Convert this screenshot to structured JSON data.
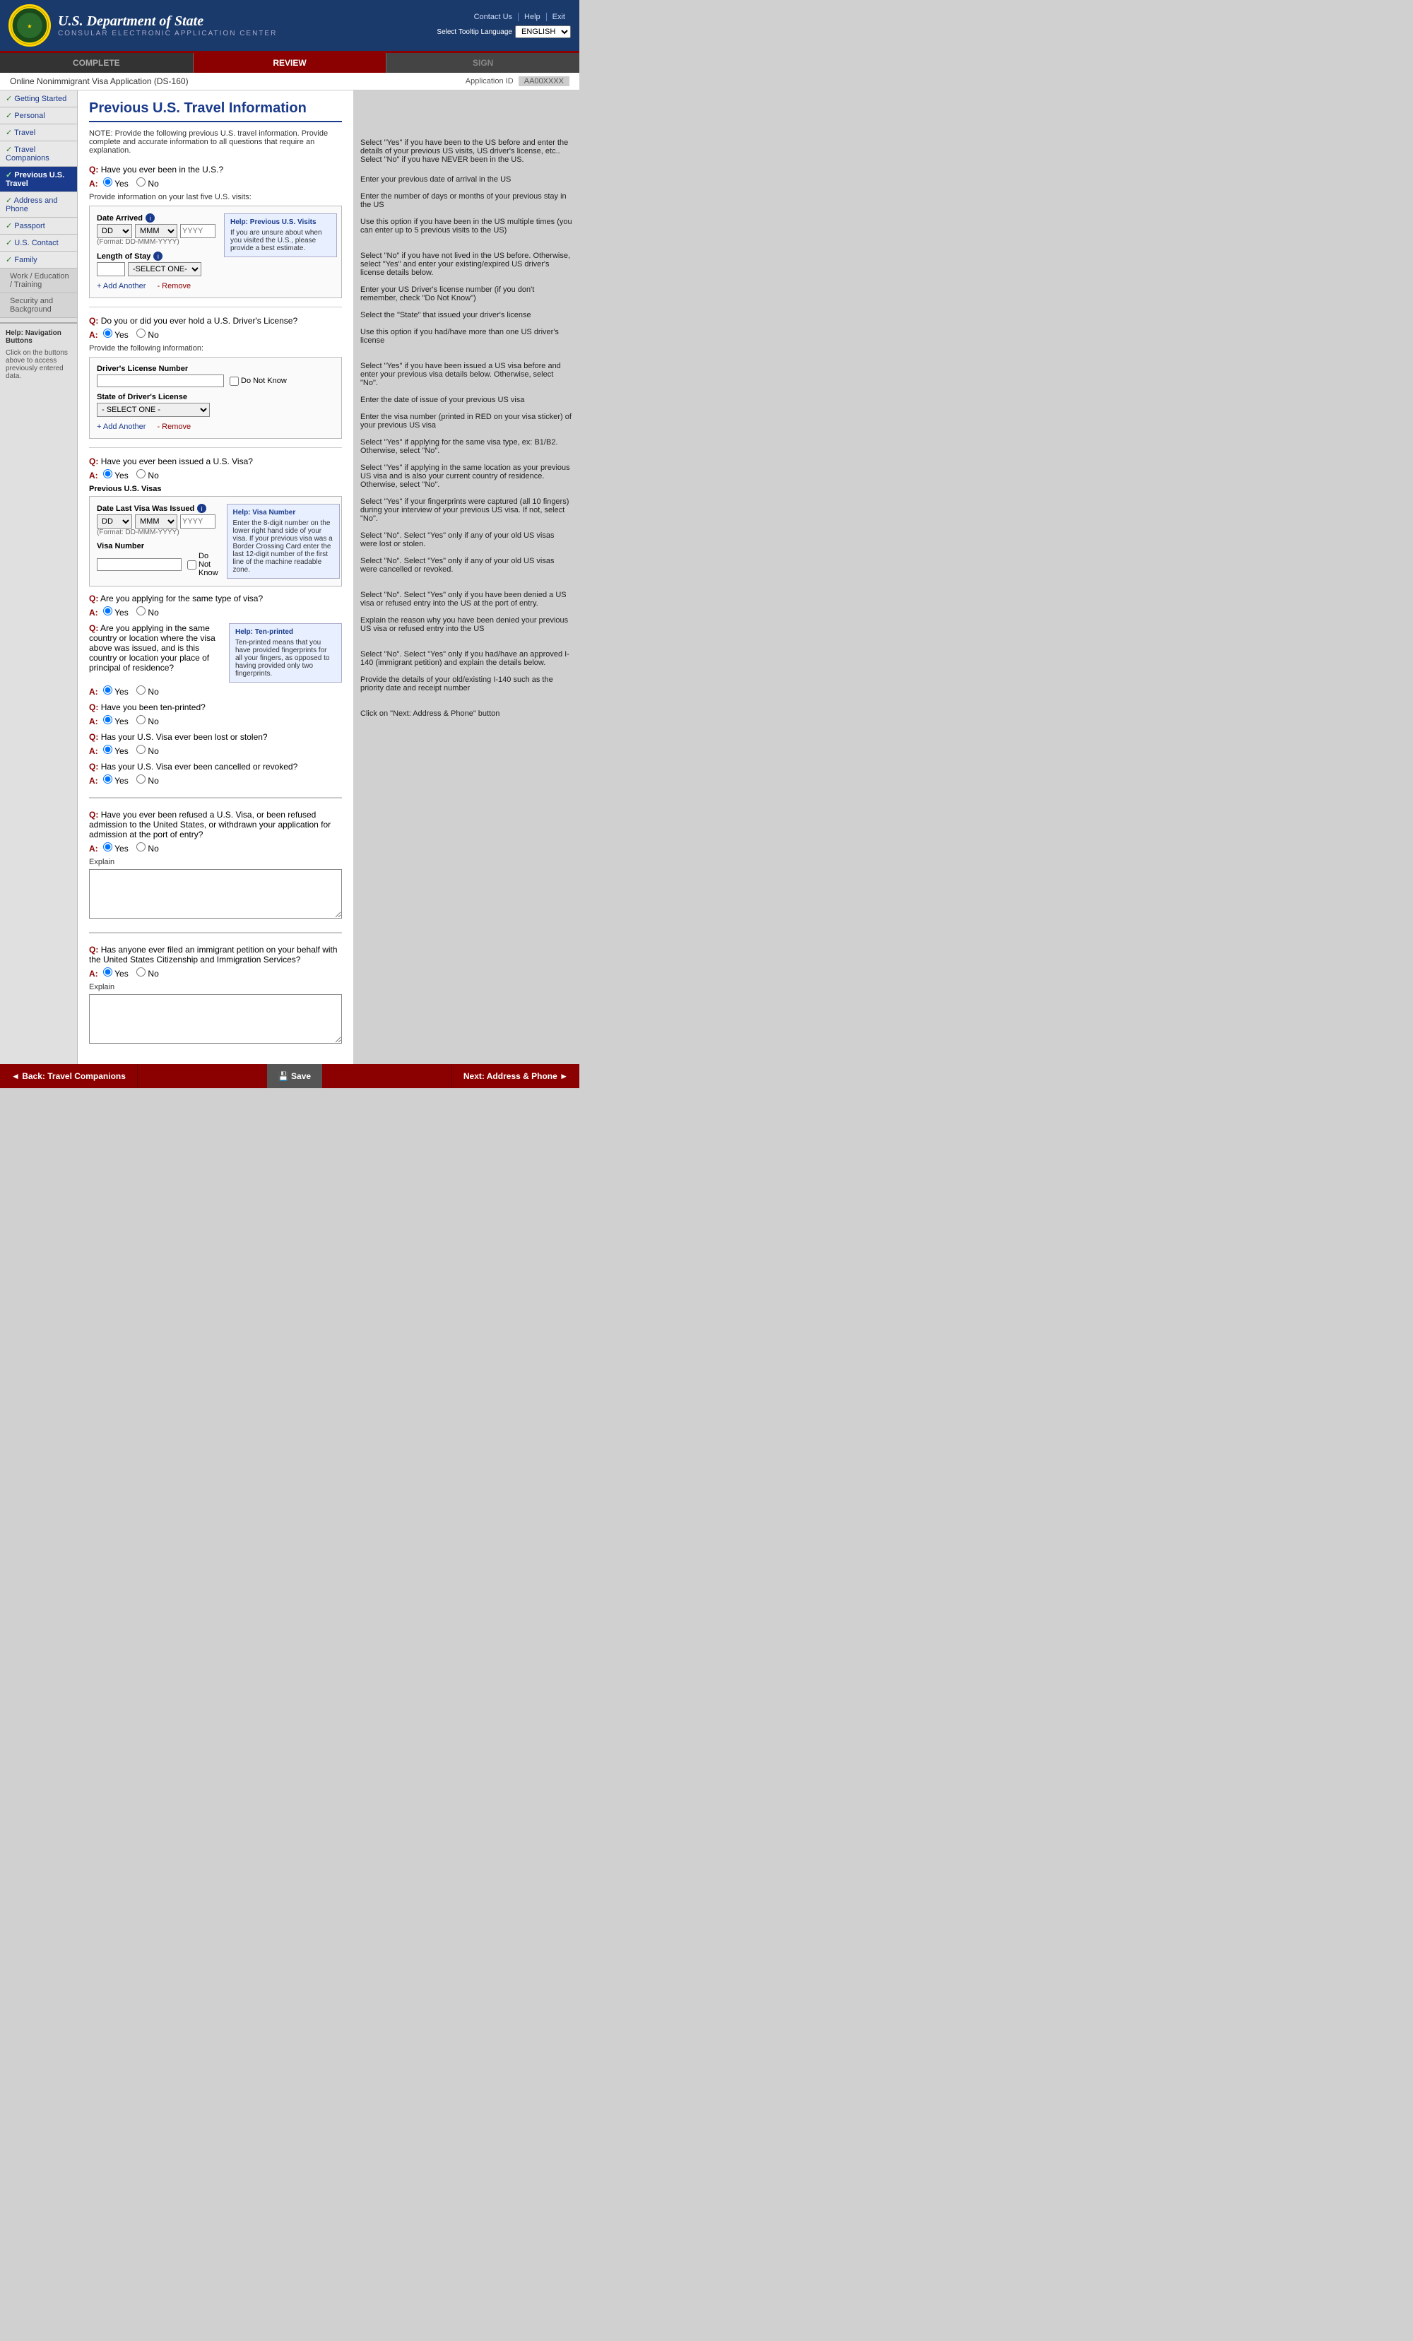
{
  "header": {
    "seal_text": "SEAL",
    "dept_name": "U.S. Department of State",
    "sub_name": "CONSULAR ELECTRONIC APPLICATION CENTER",
    "links": [
      "Contact Us",
      "Help",
      "Exit"
    ],
    "lang_label": "Select Tooltip Language",
    "lang_value": "ENGLISH"
  },
  "progress": {
    "steps": [
      {
        "label": "COMPLETE",
        "state": "done"
      },
      {
        "label": "REVIEW",
        "state": "active"
      },
      {
        "label": "SIGN",
        "state": "inactive"
      }
    ]
  },
  "form": {
    "title": "Online Nonimmigrant Visa Application (DS-160)",
    "app_id_label": "Application ID",
    "app_id_value": "AA00XXXX"
  },
  "sidebar": {
    "items": [
      {
        "label": "Getting Started",
        "state": "completed",
        "id": "getting-started"
      },
      {
        "label": "Personal",
        "state": "completed",
        "id": "personal"
      },
      {
        "label": "Travel",
        "state": "completed",
        "id": "travel"
      },
      {
        "label": "Travel Companions",
        "state": "completed",
        "id": "travel-companions"
      },
      {
        "label": "Previous U.S. Travel",
        "state": "active",
        "id": "previous-us-travel"
      },
      {
        "label": "Address and Phone",
        "state": "completed",
        "id": "address-phone"
      },
      {
        "label": "Passport",
        "state": "completed",
        "id": "passport"
      },
      {
        "label": "U.S. Contact",
        "state": "completed",
        "id": "us-contact"
      },
      {
        "label": "Family",
        "state": "completed",
        "id": "family"
      },
      {
        "label": "Work / Education / Training",
        "state": "sub",
        "id": "work-education"
      },
      {
        "label": "Security and Background",
        "state": "sub",
        "id": "security-background"
      }
    ],
    "help_title": "Help: Navigation Buttons",
    "help_text": "Click on the buttons above to access previously entered data."
  },
  "page": {
    "title": "Previous U.S. Travel Information",
    "note": "NOTE: Provide the following previous U.S. travel information. Provide complete and accurate information to all questions that require an explanation."
  },
  "questions": {
    "q1": {
      "text": "Have you ever been in the U.S.?",
      "answer": "Yes",
      "options": [
        "Yes",
        "No"
      ],
      "sub_label": "Provide information on your last five U.S. visits:",
      "date_arrived_label": "Date Arrived",
      "date_arrived_hint": "(Format: DD-MMM-YYYY)",
      "length_of_stay_label": "Length of Stay",
      "length_select_default": "-SELECT ONE-",
      "help_title": "Help: Previous U.S. Visits",
      "help_text": "If you are unsure about when you visited the U.S., please provide a best estimate.",
      "add_another": "Add Another",
      "remove": "Remove"
    },
    "q2": {
      "text": "Do you or did you ever hold a U.S. Driver's License?",
      "answer": "Yes",
      "options": [
        "Yes",
        "No"
      ],
      "sub_label": "Provide the following information:",
      "license_number_label": "Driver's License Number",
      "do_not_know": "Do Not Know",
      "state_label": "State of Driver's License",
      "state_default": "- SELECT ONE -",
      "add_another": "Add Another",
      "remove": "Remove"
    },
    "q3": {
      "text": "Have you ever been issued a U.S. Visa?",
      "answer": "Yes",
      "options": [
        "Yes",
        "No"
      ],
      "previous_visas_label": "Previous U.S. Visas",
      "date_issued_label": "Date Last Visa Was Issued",
      "date_issued_hint": "(Format: DD-MMM-YYYY)",
      "visa_number_label": "Visa Number",
      "do_not_know": "Do Not Know",
      "help_title": "Help: Visa Number",
      "help_text": "Enter the 8-digit number on the lower right hand side of your visa. If your previous visa was a Border Crossing Card enter the last 12-digit number of the first line of the machine readable zone."
    },
    "q4": {
      "text": "Are you applying for the same type of visa?",
      "answer": "Yes",
      "options": [
        "Yes",
        "No"
      ]
    },
    "q5": {
      "text": "Are you applying in the same country or location where the visa above was issued, and is this country or location your place of principal of residence?",
      "answer": "Yes",
      "options": [
        "Yes",
        "No"
      ],
      "help_title": "Help: Ten-printed",
      "help_text": "Ten-printed means that you have provided fingerprints for all your fingers, as opposed to having provided only two fingerprints."
    },
    "q6": {
      "text": "Have you been ten-printed?",
      "answer": "Yes",
      "options": [
        "Yes",
        "No"
      ]
    },
    "q7": {
      "text": "Has your U.S. Visa ever been lost or stolen?",
      "answer": "Yes",
      "options": [
        "Yes",
        "No"
      ]
    },
    "q8": {
      "text": "Has your U.S. Visa ever been cancelled or revoked?",
      "answer": "Yes",
      "options": [
        "Yes",
        "No"
      ]
    },
    "q9": {
      "text": "Have you ever been refused a U.S. Visa, or been refused admission to the United States, or withdrawn your application for admission at the port of entry?",
      "answer": "Yes",
      "options": [
        "Yes",
        "No"
      ],
      "explain_label": "Explain"
    },
    "q10": {
      "text": "Has anyone ever filed an immigrant petition on your behalf with the United States Citizenship and Immigration Services?",
      "answer": "Yes",
      "options": [
        "Yes",
        "No"
      ],
      "explain_label": "Explain"
    }
  },
  "annotations": {
    "a1": "Select \"Yes\" if you have been to the US before and enter the details of your previous US visits, US driver's license, etc.. Select \"No\" if you have NEVER been in the US.",
    "a2": "Enter your previous date of arrival in the US",
    "a3": "Enter the number of days or months of your previous stay in the US",
    "a4": "Use this option if you have been in the US multiple times (you can enter up to 5 previous visits to the US)",
    "a5": "Select \"No\" if you have not lived in the US before. Otherwise, select \"Yes\" and enter your existing/expired US driver's license details below.",
    "a6": "Enter your US Driver's license number (if you don't remember, check \"Do Not Know\")",
    "a7": "Select the \"State\" that issued your driver's license",
    "a8": "Use this option if you had/have more than one US driver's license",
    "a9": "Select \"Yes\" if you have been issued a US visa before and enter your previous visa details below. Otherwise, select \"No\".",
    "a10": "Enter the date of issue of your previous US visa",
    "a11": "Enter the visa number (printed in RED on your visa sticker) of your previous US visa",
    "a12": "Select \"Yes\" if applying for the same visa type, ex: B1/B2. Otherwise, select \"No\".",
    "a13": "Select \"Yes\" if applying in the same location as your previous US visa and is also your current country of residence. Otherwise, select \"No\".",
    "a14": "Select \"Yes\" if your fingerprints were captured (all 10 fingers) during your interview of your previous US visa. If not, select \"No\".",
    "a15": "Select \"No\". Select \"Yes\" only if any of your old US visas were lost or stolen.",
    "a16": "Select \"No\". Select \"Yes\" only if any of your old US visas were cancelled or revoked.",
    "a17": "Select \"No\". Select \"Yes\" only if you have been denied a US visa or refused entry into the US at the port of entry.",
    "a18": "Explain the reason why you have been denied your previous US visa or refused entry into the US",
    "a19": "Select \"No\". Select \"Yes\" only if you had/have an approved I-140 (immigrant petition) and explain the details below.",
    "a20": "Provide the details of your old/existing I-140 such as the priority date and receipt number",
    "a21": "Click on \"Next: Address & Phone\" button"
  },
  "bottom_nav": {
    "back_label": "◄ Back: Travel Companions",
    "save_label": "💾 Save",
    "next_label": "Next: Address & Phone ►"
  }
}
